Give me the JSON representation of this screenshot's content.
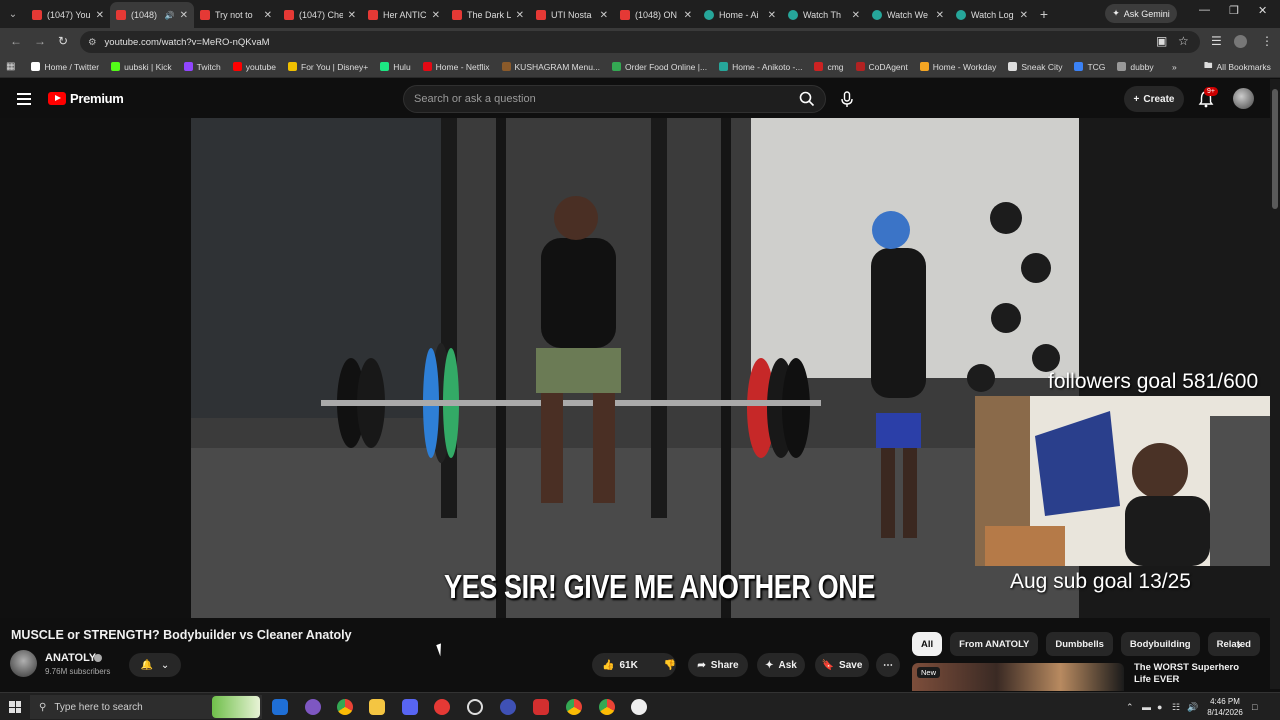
{
  "browser": {
    "tabs": [
      {
        "title": "(1047) You",
        "favicon": "youtube-icon",
        "active": false
      },
      {
        "title": "(1048)",
        "favicon": "youtube-icon",
        "active": true
      },
      {
        "title": "Try not to",
        "favicon": "youtube-icon",
        "active": false
      },
      {
        "title": "(1047) Che",
        "favicon": "youtube-icon",
        "active": false
      },
      {
        "title": "Her ANTIC",
        "favicon": "youtube-icon",
        "active": false
      },
      {
        "title": "The Dark L",
        "favicon": "youtube-icon",
        "active": false
      },
      {
        "title": "UTI Nosta",
        "favicon": "youtube-icon",
        "active": false
      },
      {
        "title": "(1048) ON",
        "favicon": "youtube-icon",
        "active": false
      },
      {
        "title": "Home - Ai",
        "favicon": "globe-icon",
        "active": false
      },
      {
        "title": "Watch Th",
        "favicon": "globe-icon",
        "active": false
      },
      {
        "title": "Watch We",
        "favicon": "globe-icon",
        "active": false
      },
      {
        "title": "Watch Log",
        "favicon": "globe-icon",
        "active": false
      }
    ],
    "ask_gemini": "Ask Gemini",
    "url": "youtube.com/watch?v=MeRO-nQKvaM",
    "bookmarks": [
      {
        "label": "Home / Twitter",
        "color": "#ffffff"
      },
      {
        "label": "uubski | Kick",
        "color": "#53fc18"
      },
      {
        "label": "Twitch",
        "color": "#9146ff"
      },
      {
        "label": "youtube",
        "color": "#ff0000"
      },
      {
        "label": "For You | Disney+",
        "color": "#f0c000"
      },
      {
        "label": "Hulu",
        "color": "#1ce783"
      },
      {
        "label": "Home - Netflix",
        "color": "#e50914"
      },
      {
        "label": "KUSHAGRAM Menu...",
        "color": "#8a5a2a"
      },
      {
        "label": "Order Food Online |...",
        "color": "#34a853"
      },
      {
        "label": "Home - Anikoto -...",
        "color": "#26a69a"
      },
      {
        "label": "cmg",
        "color": "#cc2222"
      },
      {
        "label": "CoDAgent",
        "color": "#b22222"
      },
      {
        "label": "Home - Workday",
        "color": "#f5a623"
      },
      {
        "label": "Sneak City",
        "color": "#dddddd"
      },
      {
        "label": "TCG",
        "color": "#3b82f6"
      },
      {
        "label": "dubby",
        "color": "#999999"
      }
    ],
    "all_bookmarks": "All Bookmarks"
  },
  "youtube": {
    "logo_text": "Premium",
    "search_placeholder": "Search or ask a question",
    "create_label": "Create",
    "notif_count": "9+"
  },
  "video": {
    "caption": "YES SIR! GIVE ME ANOTHER ONE",
    "overlay_followers": "followers goal 581/600",
    "overlay_subs": "Aug sub goal 13/25",
    "title": "MUSCLE or STRENGTH? Bodybuilder vs Cleaner Anatoly",
    "channel": "ANATOLY",
    "subscribers": "9.76M subscribers",
    "likes": "61K",
    "share": "Share",
    "ask": "Ask",
    "save": "Save"
  },
  "sidebar": {
    "chips": [
      "All",
      "From ANATOLY",
      "Dumbbells",
      "Bodybuilding",
      "Related"
    ],
    "rec_badge": "New",
    "rec_title": "The WORST Superhero Life EVER"
  },
  "taskbar": {
    "search_placeholder": "Type here to search",
    "time": "4:46 PM",
    "date": "8/14/2026"
  },
  "colors": {
    "yt_red": "#ff0000",
    "background": "#0f0f0f",
    "chip_selected": "#f1f1f1"
  }
}
